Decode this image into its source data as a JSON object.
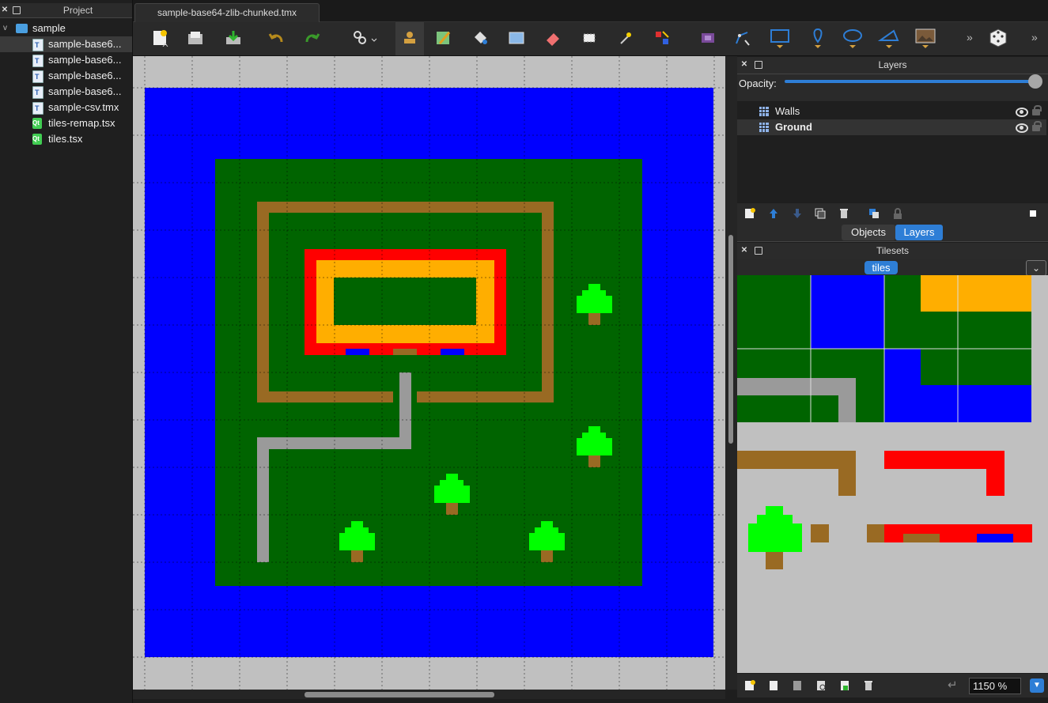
{
  "project_panel": {
    "title": "Project",
    "items": [
      {
        "label": "sample",
        "type": "folder"
      },
      {
        "label": "sample-base6...",
        "type": "tmx"
      },
      {
        "label": "sample-base6...",
        "type": "tmx"
      },
      {
        "label": "sample-base6...",
        "type": "tmx"
      },
      {
        "label": "sample-base6...",
        "type": "tmx"
      },
      {
        "label": "sample-csv.tmx",
        "type": "tmx"
      },
      {
        "label": "tiles-remap.tsx",
        "type": "tsx"
      },
      {
        "label": "tiles.tsx",
        "type": "tsx"
      }
    ]
  },
  "document_tab": {
    "label": "sample-base64-zlib-chunked.tmx"
  },
  "toolbar": {
    "icons": [
      "new-map-icon",
      "open-icon",
      "save-icon",
      "undo-icon",
      "redo-icon",
      "command-icon",
      "stamp-brush-icon",
      "terrain-brush-icon",
      "bucket-fill-icon",
      "shape-fill-icon",
      "eraser-icon",
      "rect-select-icon",
      "magic-wand-icon",
      "select-same-tile-icon",
      "insert-tile-icon",
      "edit-polygon-icon",
      "insert-rectangle-icon",
      "insert-point-icon",
      "insert-ellipse-icon",
      "insert-polygon-icon",
      "insert-image-icon",
      "overflow-icon",
      "random-mode-icon",
      "overflow-icon-2"
    ]
  },
  "layers_panel": {
    "title": "Layers",
    "opacity_label": "Opacity:",
    "opacity": 1.0,
    "layers": [
      {
        "name": "Walls",
        "visible": true,
        "locked": false,
        "selected": false
      },
      {
        "name": "Ground",
        "visible": true,
        "locked": false,
        "selected": true
      }
    ]
  },
  "dock_tabs": {
    "objects": "Objects",
    "layers": "Layers",
    "active": "Layers"
  },
  "tilesets_panel": {
    "title": "Tilesets",
    "active_tileset": "tiles"
  },
  "zoom": {
    "value": "1150 %"
  },
  "colors": {
    "water": "#0000ff",
    "grass": "#006400",
    "dirt": "#996a23",
    "wall_red": "#ff0000",
    "floor_orange": "#ffae00",
    "road_gray": "#9a9a9a",
    "tree_green": "#00ff00",
    "accent": "#2e7ed6"
  }
}
